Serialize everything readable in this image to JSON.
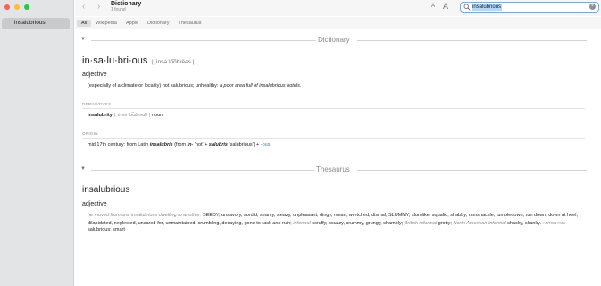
{
  "sidebar": {
    "items": [
      {
        "label": "insalubrious"
      }
    ]
  },
  "toolbar": {
    "title": "Dictionary",
    "subtitle": "1 found",
    "back_icon": "‹",
    "forward_icon": "›",
    "font_small_label": "A",
    "font_large_label": "A"
  },
  "search": {
    "value": "insalubrious",
    "clear_icon": "×"
  },
  "tabs": [
    {
      "label": "All",
      "active": true
    },
    {
      "label": "Wikipedia",
      "active": false
    },
    {
      "label": "Apple",
      "active": false
    },
    {
      "label": "Dictionary",
      "active": false
    },
    {
      "label": "Thesaurus",
      "active": false
    }
  ],
  "dictionary": {
    "section_label": "Dictionary",
    "headword": "in·sa·lu·bri·ous",
    "pronunciation": "| ˌinsəˈlo͞obrēəs |",
    "pos": "adjective",
    "definition": "(especially of a climate or locality) not salubrious; unhealthy:",
    "example": "a poor area full of insalubrious hotels.",
    "derivatives_label": "DERIVATIVES",
    "derivative_word": "insalubrity",
    "derivative_pron": "| ˌinsəˈlo͞obrədē |",
    "derivative_pos": "noun",
    "origin_label": "ORIGIN",
    "origin_prefix": "mid 17th century: from Latin",
    "origin_latin": "insalubris",
    "origin_from": "(from",
    "origin_in": "in-",
    "origin_not": "'not' +",
    "origin_salubris": "salubris",
    "origin_salubrious": "'salubrious') +",
    "origin_suffix": "-ous",
    "origin_end": "."
  },
  "thesaurus": {
    "section_label": "Thesaurus",
    "headword": "insalubrious",
    "pos": "adjective",
    "example": "he moved from one insalubrious dwelling to another:",
    "synonyms_main": "SEEDY, unsavory, sordid, seamy, sleazy, unpleasant, dingy, mean, wretched, dismal; SLUMMY, slumlike, squalid, shabby, ramshackle, tumbledown, run down, down at heel, dilapidated, neglected, uncared-for, unmaintained, crumbling, decaying, gone to rack and ruin;",
    "informal_label": "informal",
    "informal_words": "scruffy, scuzzy, crummy, grungy, shambly;",
    "british_label": "British informal",
    "british_words": "grotty;",
    "na_label": "North American informal",
    "na_words": "shacky, skanky.",
    "antonyms_label": "ANTONYMS",
    "antonyms": "salubrious; smart"
  }
}
